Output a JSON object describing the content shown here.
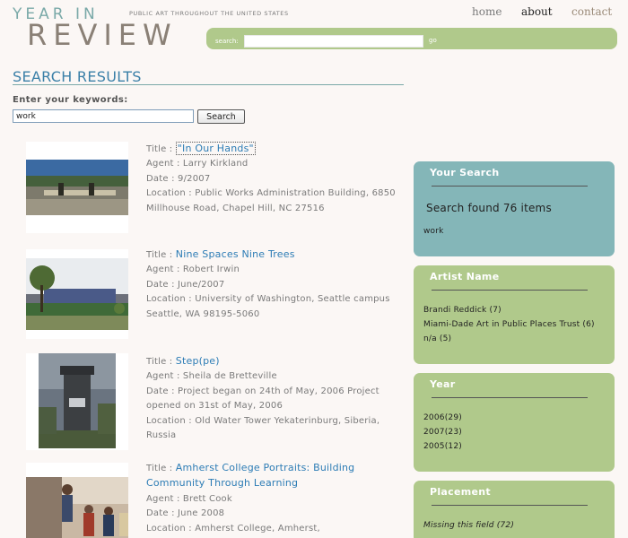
{
  "header": {
    "logo_top": "YEAR IN",
    "logo_bottom": "REVIEW",
    "tagline": "PUBLIC ART THROUGHOUT THE UNITED STATES",
    "nav": {
      "home": "home",
      "about": "about",
      "contact": "contact"
    },
    "search": {
      "label": "search:",
      "value": "",
      "go": "go"
    }
  },
  "main": {
    "title": "SEARCH RESULTS",
    "keyword_label": "Enter your keywords:",
    "keyword_value": "work",
    "search_button": "Search",
    "results": [
      {
        "title_label": "Title :",
        "title": "\"In Our Hands\"",
        "agent": "Agent : Larry Kirkland",
        "date": "Date : 9/2007",
        "location": "Location : Public Works Administration Building, 6850 Millhouse Road, Chapel Hill, NC 27516"
      },
      {
        "title_label": "Title :",
        "title": "Nine Spaces Nine Trees",
        "agent": "Agent : Robert Irwin",
        "date": "Date : June/2007",
        "location": "Location : University of Washington, Seattle campus Seattle, WA 98195-5060"
      },
      {
        "title_label": "Title :",
        "title": "Step(pe)",
        "agent": "Agent : Sheila de Bretteville",
        "date": "Date : Project began on 24th of May, 2006 Project opened on 31st of May, 2006",
        "location": "Location : Old Water Tower Yekaterinburg, Siberia, Russia"
      },
      {
        "title_label": "Title :",
        "title": "Amherst College Portraits: Building Community Through Learning",
        "agent": "Agent : Brett Cook",
        "date": "Date : June 2008",
        "location": "Location : Amherst College, Amherst,"
      }
    ]
  },
  "sidebar": {
    "your_search": {
      "heading": "Your Search",
      "summary": "Search found 76 items",
      "term": "work"
    },
    "artist_name": {
      "heading": "Artist Name",
      "items": [
        "Brandi Reddick (7)",
        "Miami-Dade Art in Public Places Trust (6)",
        "n/a (5)"
      ]
    },
    "year": {
      "heading": "Year",
      "items": [
        "2006(29)",
        "2007(23)",
        "2005(12)"
      ]
    },
    "placement": {
      "heading": "Placement",
      "items": [
        "Missing this field (72)"
      ]
    }
  },
  "colors": {
    "accent_blue": "#2c7cb5",
    "teal": "#84b6b8",
    "green": "#b0c98b"
  }
}
